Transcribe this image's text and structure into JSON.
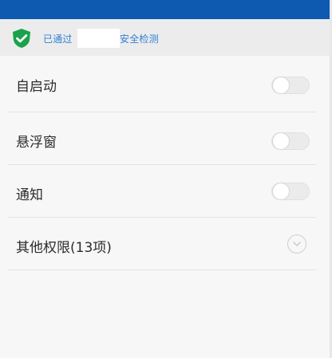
{
  "colors": {
    "primary": "#0d5ab0",
    "link": "#2f7fd6",
    "shield": "#1aa34a"
  },
  "security": {
    "icon": "shield-check-icon",
    "text_left": "已通过",
    "text_right": "安全检测"
  },
  "permissions": [
    {
      "label": "自启动",
      "control": "toggle",
      "enabled": false
    },
    {
      "label": "悬浮窗",
      "control": "toggle",
      "enabled": false
    },
    {
      "label": "通知",
      "control": "toggle",
      "enabled": false
    },
    {
      "label": "其他权限(13项)",
      "control": "expand",
      "icon": "chevron-down-icon"
    }
  ]
}
